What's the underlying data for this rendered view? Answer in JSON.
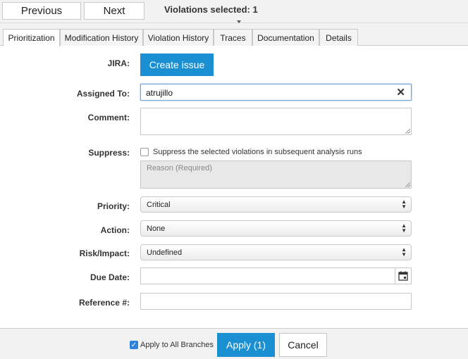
{
  "toolbar": {
    "previous_label": "Previous",
    "next_label": "Next",
    "selection_text": "Violations selected: 1"
  },
  "tabs": [
    {
      "label": "Prioritization",
      "active": true
    },
    {
      "label": "Modification History",
      "active": false
    },
    {
      "label": "Violation History",
      "active": false
    },
    {
      "label": "Traces",
      "active": false
    },
    {
      "label": "Documentation",
      "active": false
    },
    {
      "label": "Details",
      "active": false
    }
  ],
  "form": {
    "jira_label": "JIRA:",
    "create_issue_label": "Create issue",
    "assigned_label": "Assigned To:",
    "assigned_value": "atrujillo",
    "comment_label": "Comment:",
    "comment_value": "",
    "suppress_label": "Suppress:",
    "suppress_checkbox_text": "Suppress the selected violations in subsequent analysis runs",
    "suppress_checked": false,
    "reason_placeholder": "Reason (Required)",
    "priority_label": "Priority:",
    "priority_value": "Critical",
    "action_label": "Action:",
    "action_value": "None",
    "risk_label": "Risk/Impact:",
    "risk_value": "Undefined",
    "due_date_label": "Due Date:",
    "due_date_value": "",
    "reference_label": "Reference #:",
    "reference_value": ""
  },
  "footer": {
    "apply_all_label": "Apply to All Branches",
    "apply_all_checked": true,
    "apply_label": "Apply (1)",
    "cancel_label": "Cancel"
  },
  "colors": {
    "primary_button": "#1a8fd2",
    "checkbox_checked": "#2f83d9",
    "toolbar_bg": "#f2f2f2"
  },
  "icons": {
    "clear": "close-icon",
    "calendar": "calendar-icon",
    "select_arrows": "updown-arrows-icon"
  }
}
